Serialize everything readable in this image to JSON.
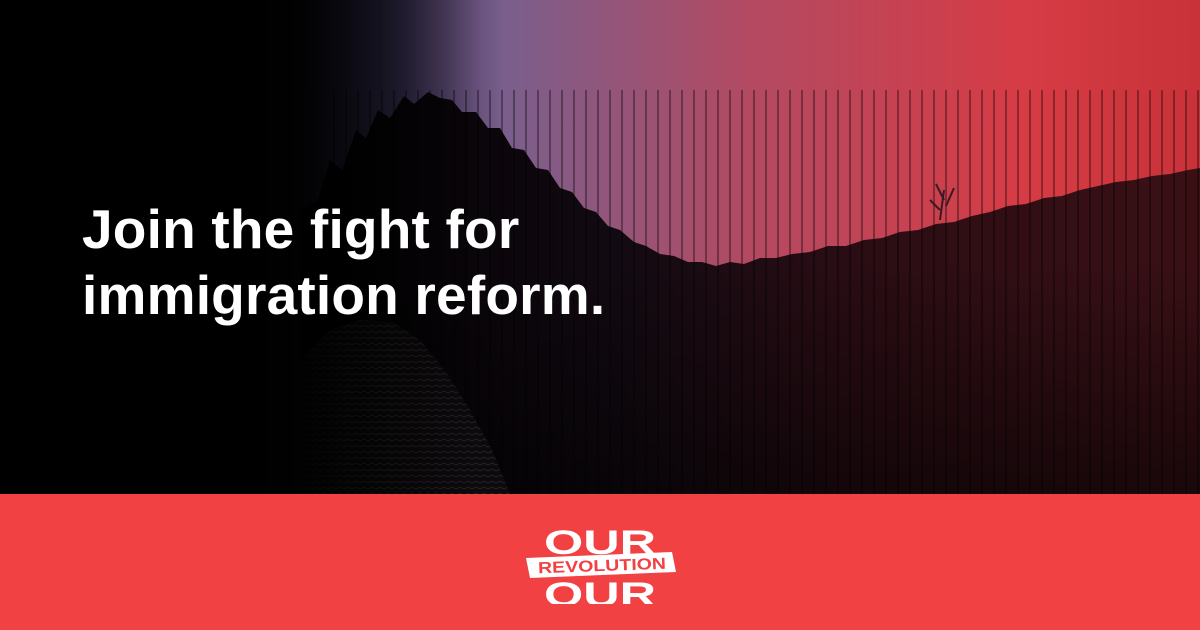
{
  "hero": {
    "headline_line1": "Join the fight for",
    "headline_line2": "immigration reform."
  },
  "logo": {
    "word_top": "OUR",
    "word_middle": "REVOLUTION",
    "word_bottom": "OUR"
  },
  "colors": {
    "brand_red": "#f24143",
    "logo_white": "#ffffff",
    "sky_left": "#000000",
    "sky_mid": "#7a5f8d",
    "sky_right": "#d9343a",
    "wall_dark": "#1a0a10"
  },
  "icons": {
    "background_image": "border-wall-photo",
    "brand_logo": "our-revolution-logo"
  }
}
